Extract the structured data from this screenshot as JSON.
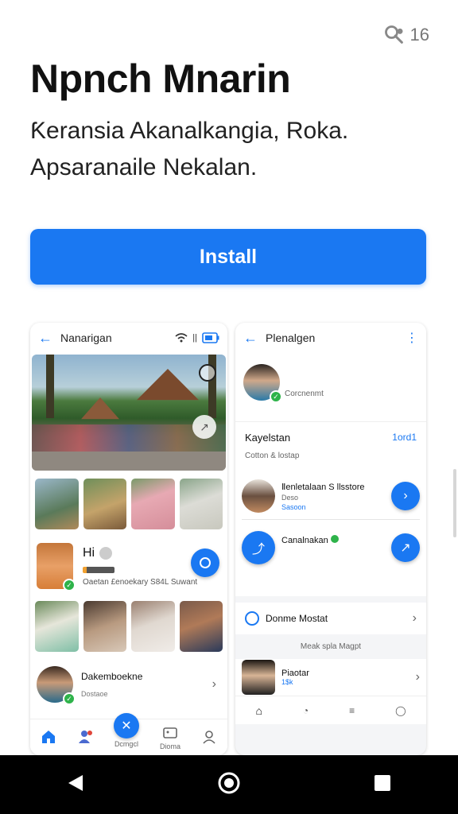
{
  "status_chip": {
    "icon": "search-person-icon",
    "count": "16"
  },
  "app": {
    "title": "Npnch Mnarin",
    "description": "Ƙeransia Akanalkangia, Roka. Apsaranaile Nekalan."
  },
  "install_label": "Install",
  "left_shot": {
    "header_title": "Nanarigan",
    "hero_icon": "record-icon",
    "hi_text": "Hi",
    "caption": "Oaetan £enoekary S84L Suwant",
    "contact_name": "Dakemboekne",
    "contact_sub": "Dostaoe",
    "nav": [
      "",
      "",
      "Dcmgcl",
      "Dioma",
      ""
    ]
  },
  "right_shot": {
    "header_title": "Plenalgen",
    "profile_caption": "Corcnenmt",
    "section_title": "Kayelstan",
    "section_link": "1ord1",
    "section_sub": "Cotton & lostap",
    "item1_title": "Ⅱenletalaan S llsstore",
    "item1_sub1": "Deso",
    "item1_sub2": "Sasoon",
    "item2_title": "Canalnakan",
    "menu_item": "Donme Mostat",
    "note": "Meak spla Magpt",
    "person_name": "Piaotar",
    "person_sub": "1$k"
  },
  "colors": {
    "accent": "#1a78f2",
    "success": "#2eb34a"
  }
}
